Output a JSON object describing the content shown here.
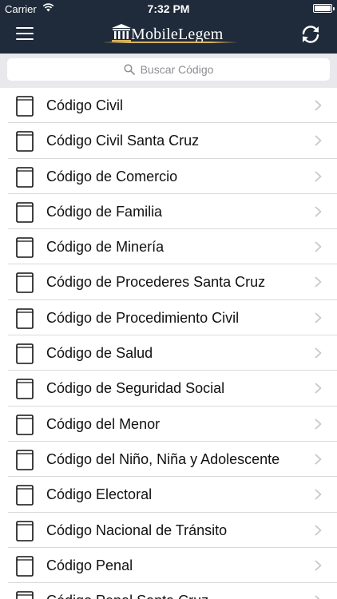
{
  "status_bar": {
    "carrier": "Carrier",
    "time": "7:32 PM"
  },
  "header": {
    "title": "MobileLegem",
    "menu_icon": "hamburger-menu-icon",
    "refresh_icon": "refresh-icon"
  },
  "search": {
    "placeholder": "Buscar Código",
    "value": ""
  },
  "colors": {
    "nav_bg": "#1f2a3a",
    "accent_gold": "#d9b35b",
    "search_bg": "#e8e8ed"
  },
  "codes": [
    "Código Civil",
    "Código Civil Santa Cruz",
    "Código de Comercio",
    "Código de Familia",
    "Código de Minería",
    "Código de Procederes Santa Cruz",
    "Código de Procedimiento Civil",
    "Código de Salud",
    "Código de Seguridad Social",
    "Código del Menor",
    "Código del Niño, Niña y Adolescente",
    "Código Electoral",
    "Código Nacional de Tránsito",
    "Código Penal",
    "Código Penal Santa Cruz"
  ]
}
